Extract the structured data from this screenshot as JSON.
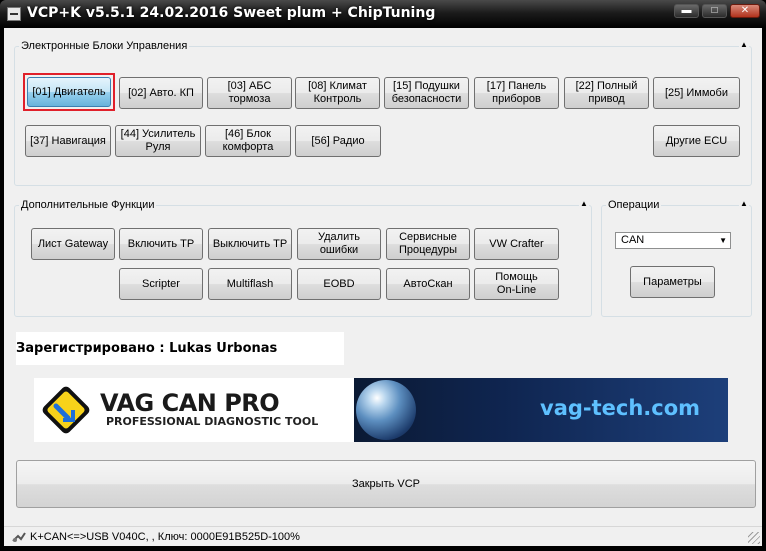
{
  "window": {
    "title": "VCP+K v5.5.1 24.02.2016 Sweet plum + ChipTuning",
    "minimize_glyph": "▬",
    "maximize_glyph": "□",
    "close_glyph": "✕"
  },
  "ecu_group": {
    "title": "Электронные Блоки Управления",
    "buttons": [
      "[01] Двигатель",
      "[02] Авто. КП",
      "[03] АБС\nтормоза",
      "[08] Климат\nКонтроль",
      "[15] Подушки\nбезопасности",
      "[17] Панель\nприборов",
      "[22] Полный\nпривод",
      "[25] Иммоби",
      "[37] Навигация",
      "[44] Усилитель\nРуля",
      "[46] Блок\nкомфорта",
      "[56] Радио"
    ],
    "other_ecu": "Другие ECU"
  },
  "extra_group": {
    "title": "Дополнительные Функции",
    "buttons": [
      "Лист Gateway",
      "Включить ТР",
      "Выключить ТР",
      "Удалить\nошибки",
      "Сервисные\nПроцедуры",
      "VW Crafter",
      "Scripter",
      "Multiflash",
      "EOBD",
      "АвтоСкан",
      "Помощь\nOn-Line"
    ]
  },
  "operations_group": {
    "title": "Операции",
    "protocol_value": "CAN",
    "params_button": "Параметры"
  },
  "registered": "Зарегистрировано : Lukas Urbonas",
  "banner": {
    "brand": "VAG CAN PRO",
    "tagline": "PROFESSIONAL DIAGNOSTIC TOOL",
    "website": "vag-tech.com"
  },
  "close_button": "Закрыть VCP",
  "status": "K+CAN<=>USB V040C, , Ключ: 0000E91B525D-100%",
  "colors": {
    "accent_red": "#e0202a",
    "banner_yellow": "#f7d21a",
    "website_blue": "#5ec0ff"
  }
}
